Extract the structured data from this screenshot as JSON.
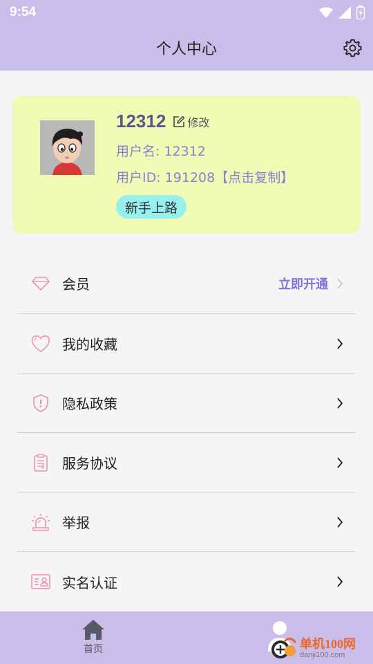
{
  "status_bar": {
    "time": "9:54"
  },
  "header": {
    "title": "个人中心"
  },
  "profile": {
    "nickname": "12312",
    "edit_label": "修改",
    "username_line": "用户名: 12312",
    "userid_line": "用户ID: 191208【点击复制】",
    "badge": "新手上路"
  },
  "menu": {
    "vip": {
      "label": "会员",
      "action": "立即开通",
      "icon": "diamond-icon"
    },
    "favorites": {
      "label": "我的收藏",
      "icon": "heart-icon"
    },
    "privacy": {
      "label": "隐私政策",
      "icon": "shield-icon"
    },
    "agreement": {
      "label": "服务协议",
      "icon": "document-icon"
    },
    "report": {
      "label": "举报",
      "icon": "alarm-icon"
    },
    "realname": {
      "label": "实名认证",
      "icon": "id-card-icon"
    }
  },
  "tabbar": {
    "home": {
      "label": "首页",
      "icon": "home-icon"
    },
    "mine": {
      "icon": "person-icon"
    }
  },
  "watermark": {
    "cn": "单机100网",
    "en": "danji100.com"
  },
  "colors": {
    "header_bg": "#cbbde9",
    "card_bg": "#f0fab5",
    "accent": "#8570d8",
    "icon_pink": "#f08cb0",
    "badge_bg": "#97f0f0"
  }
}
